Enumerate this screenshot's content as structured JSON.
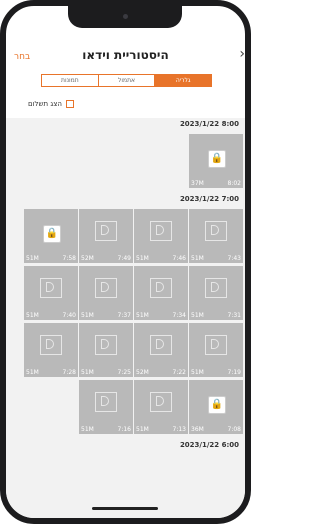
{
  "header": {
    "back_label": "בחר",
    "title": "היסטוריית וידאו",
    "chevron": "›"
  },
  "tabs": [
    {
      "label": "גלריה",
      "active": true
    },
    {
      "label": "אתמול",
      "active": false
    },
    {
      "label": "תמונות",
      "active": false
    }
  ],
  "filter": {
    "paid_label": "הצג תשלום"
  },
  "groups": [
    {
      "date": "2023/1/22 8:00",
      "thumbs": [
        {
          "size": "37M",
          "time": "8:02",
          "locked": true
        }
      ]
    },
    {
      "date": "2023/1/22 7:00",
      "thumbs": [
        {
          "size": "51M",
          "time": "7:43",
          "locked": false
        },
        {
          "size": "51M",
          "time": "7:46",
          "locked": false
        },
        {
          "size": "52M",
          "time": "7:49",
          "locked": false
        },
        {
          "size": "51M",
          "time": "7:58",
          "locked": true
        },
        {
          "size": "51M",
          "time": "7:31",
          "locked": false
        },
        {
          "size": "51M",
          "time": "7:34",
          "locked": false
        },
        {
          "size": "51M",
          "time": "7:37",
          "locked": false
        },
        {
          "size": "51M",
          "time": "7:40",
          "locked": false
        },
        {
          "size": "51M",
          "time": "7:19",
          "locked": false
        },
        {
          "size": "52M",
          "time": "7:22",
          "locked": false
        },
        {
          "size": "51M",
          "time": "7:25",
          "locked": false
        },
        {
          "size": "51M",
          "time": "7:28",
          "locked": false
        },
        {
          "size": "36M",
          "time": "7:08",
          "locked": true
        },
        {
          "size": "51M",
          "time": "7:13",
          "locked": false
        },
        {
          "size": "51M",
          "time": "7:16",
          "locked": false
        }
      ]
    },
    {
      "date": "2023/1/22 6:00",
      "thumbs": []
    }
  ],
  "colors": {
    "accent": "#e8742a",
    "thumb_bg": "#b9b9b9"
  }
}
